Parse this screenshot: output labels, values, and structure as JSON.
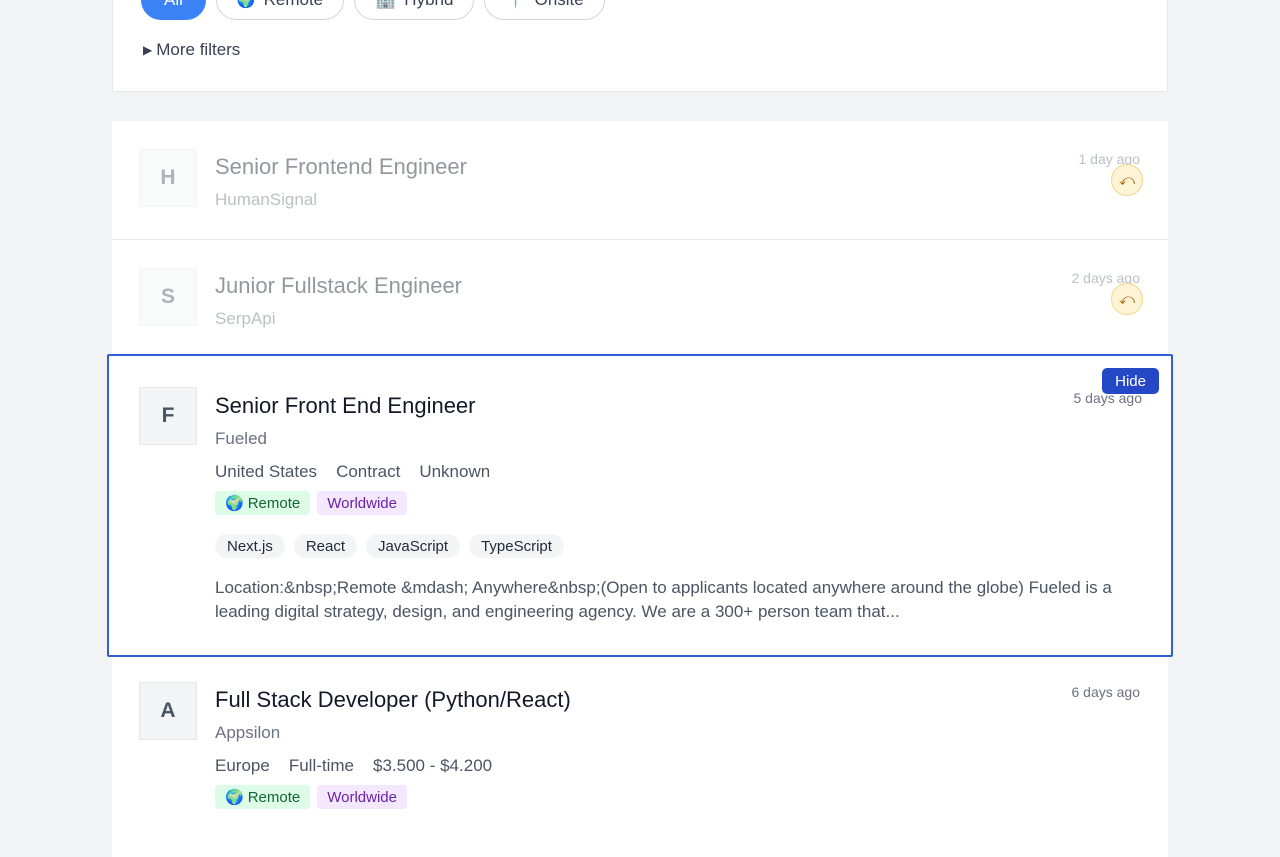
{
  "filters": {
    "chips": [
      {
        "label": "All",
        "icon": "",
        "active": true
      },
      {
        "label": "Remote",
        "icon": "🌍",
        "active": false
      },
      {
        "label": "Hybrid",
        "icon": "🏢",
        "active": false
      },
      {
        "label": "Onsite",
        "icon": "📍",
        "active": false
      }
    ],
    "more_filters_label": "More filters",
    "more_filters_icon": "▶"
  },
  "jobs": [
    {
      "logo_letter": "H",
      "title": "Senior Frontend Engineer",
      "company": "HumanSignal",
      "posted": "1 day ago",
      "hidden": true,
      "undo_icon": "⤺"
    },
    {
      "logo_letter": "S",
      "title": "Junior Fullstack Engineer",
      "company": "SerpApi",
      "posted": "2 days ago",
      "hidden": true,
      "undo_icon": "⤺"
    },
    {
      "logo_letter": "F",
      "title": "Senior Front End Engineer",
      "company": "Fueled",
      "posted": "5 days ago",
      "hide_label": "Hide",
      "meta": [
        "United States",
        "Contract",
        "Unknown"
      ],
      "tags": [
        {
          "icon": "🌍",
          "label": "Remote",
          "color": "#dcfce7"
        },
        {
          "icon": "",
          "label": "Worldwide",
          "color": "#f3e8ff"
        }
      ],
      "tech": [
        "Next.js",
        "React",
        "JavaScript",
        "TypeScript"
      ],
      "description": "Location:&nbsp;Remote &mdash; Anywhere&nbsp;(Open to applicants located anywhere around the globe) Fueled is a leading digital strategy, design, and engineering agency. We are a 300+ person team that..."
    },
    {
      "logo_letter": "A",
      "title": "Full Stack Developer (Python/React)",
      "company": "Appsilon",
      "posted": "6 days ago",
      "meta": [
        "Europe",
        "Full-time",
        "$3.500 - $4.200"
      ],
      "tags": [
        {
          "icon": "🌍",
          "label": "Remote",
          "color": "#dcfce7"
        },
        {
          "icon": "",
          "label": "Worldwide",
          "color": "#f3e8ff"
        }
      ]
    }
  ],
  "colors": {
    "accent": "#3b82f6",
    "selected_border": "#2f5fd6",
    "hide_button": "#2548c6"
  }
}
